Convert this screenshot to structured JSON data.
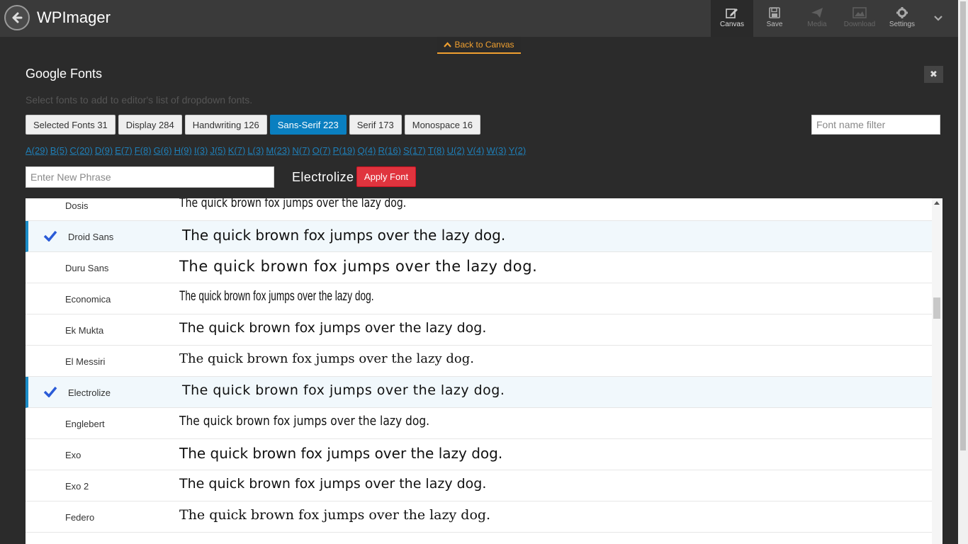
{
  "app": {
    "title": "WPImager"
  },
  "toolbar": [
    {
      "label": "Canvas",
      "icon": "edit-icon"
    },
    {
      "label": "Save",
      "icon": "save-icon"
    },
    {
      "label": "Media",
      "icon": "send-icon"
    },
    {
      "label": "Download",
      "icon": "image-icon"
    },
    {
      "label": "Settings",
      "icon": "gear-icon"
    }
  ],
  "back_to_canvas": "Back to Canvas",
  "panel": {
    "title": "Google Fonts",
    "subtitle": "Select fonts to add to editor's list of dropdown fonts.",
    "close": "✖"
  },
  "tabs": [
    {
      "label": "Selected Fonts 31",
      "active": false
    },
    {
      "label": "Display 284",
      "active": false
    },
    {
      "label": "Handwriting 126",
      "active": false
    },
    {
      "label": "Sans-Serif 223",
      "active": true
    },
    {
      "label": "Serif 173",
      "active": false
    },
    {
      "label": "Monospace 16",
      "active": false
    }
  ],
  "filter_placeholder": "Font name filter",
  "letters": [
    "A(29)",
    "B(5)",
    "C(20)",
    "D(9)",
    "E(7)",
    "F(8)",
    "G(6)",
    "H(9)",
    "I(3)",
    "J(5)",
    "K(7)",
    "L(3)",
    "M(23)",
    "N(7)",
    "O(7)",
    "P(19)",
    "Q(4)",
    "R(16)",
    "S(17)",
    "T(8)",
    "U(2)",
    "V(4)",
    "W(3)",
    "Y(2)"
  ],
  "phrase_placeholder": "Enter New Phrase",
  "selected_font": "Electrolize",
  "apply_label": "Apply Font",
  "sample_text": "The quick brown fox jumps over the lazy dog.",
  "fonts": [
    {
      "name": "Dosis",
      "selected": false
    },
    {
      "name": "Droid Sans",
      "selected": true
    },
    {
      "name": "Duru Sans",
      "selected": false
    },
    {
      "name": "Economica",
      "selected": false
    },
    {
      "name": "Ek Mukta",
      "selected": false
    },
    {
      "name": "El Messiri",
      "selected": false
    },
    {
      "name": "Electrolize",
      "selected": true
    },
    {
      "name": "Englebert",
      "selected": false
    },
    {
      "name": "Exo",
      "selected": false
    },
    {
      "name": "Exo 2",
      "selected": false
    },
    {
      "name": "Federo",
      "selected": false
    }
  ],
  "colors": {
    "accent": "#0a7fc0",
    "apply": "#e0343e",
    "link": "#1e7fb8",
    "back_to_canvas": "#f0a030"
  }
}
